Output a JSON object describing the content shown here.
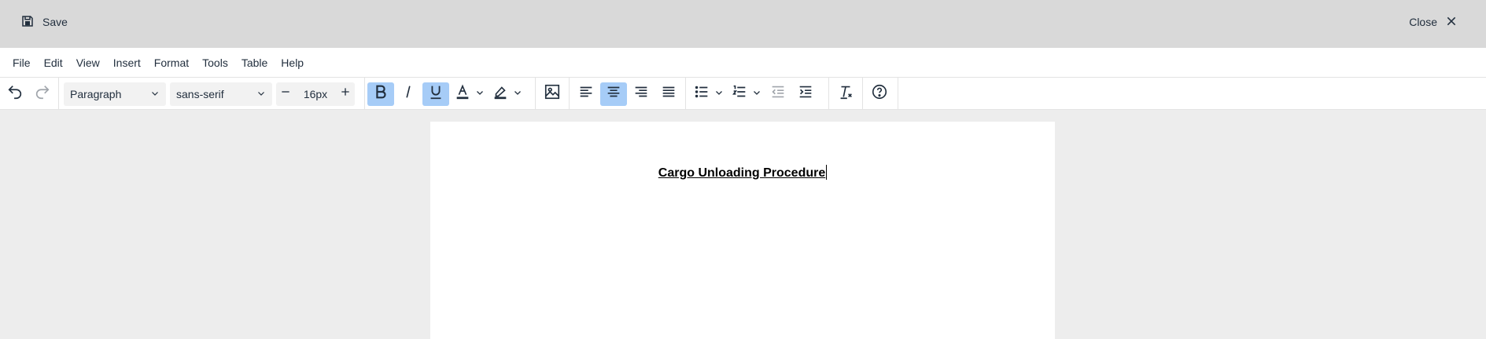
{
  "header": {
    "save_label": "Save",
    "close_label": "Close"
  },
  "menubar": {
    "items": [
      "File",
      "Edit",
      "View",
      "Insert",
      "Format",
      "Tools",
      "Table",
      "Help"
    ]
  },
  "toolbar": {
    "block_format": "Paragraph",
    "font_family": "sans-serif",
    "font_size": "16px",
    "active": [
      "bold",
      "underline",
      "align-center"
    ]
  },
  "document": {
    "title": "Cargo Unloading Procedure"
  },
  "colors": {
    "topbar": "#d9d9d9",
    "active_button": "#a6ccf7",
    "canvas_bg": "#ededed",
    "text": "#222f3e"
  }
}
